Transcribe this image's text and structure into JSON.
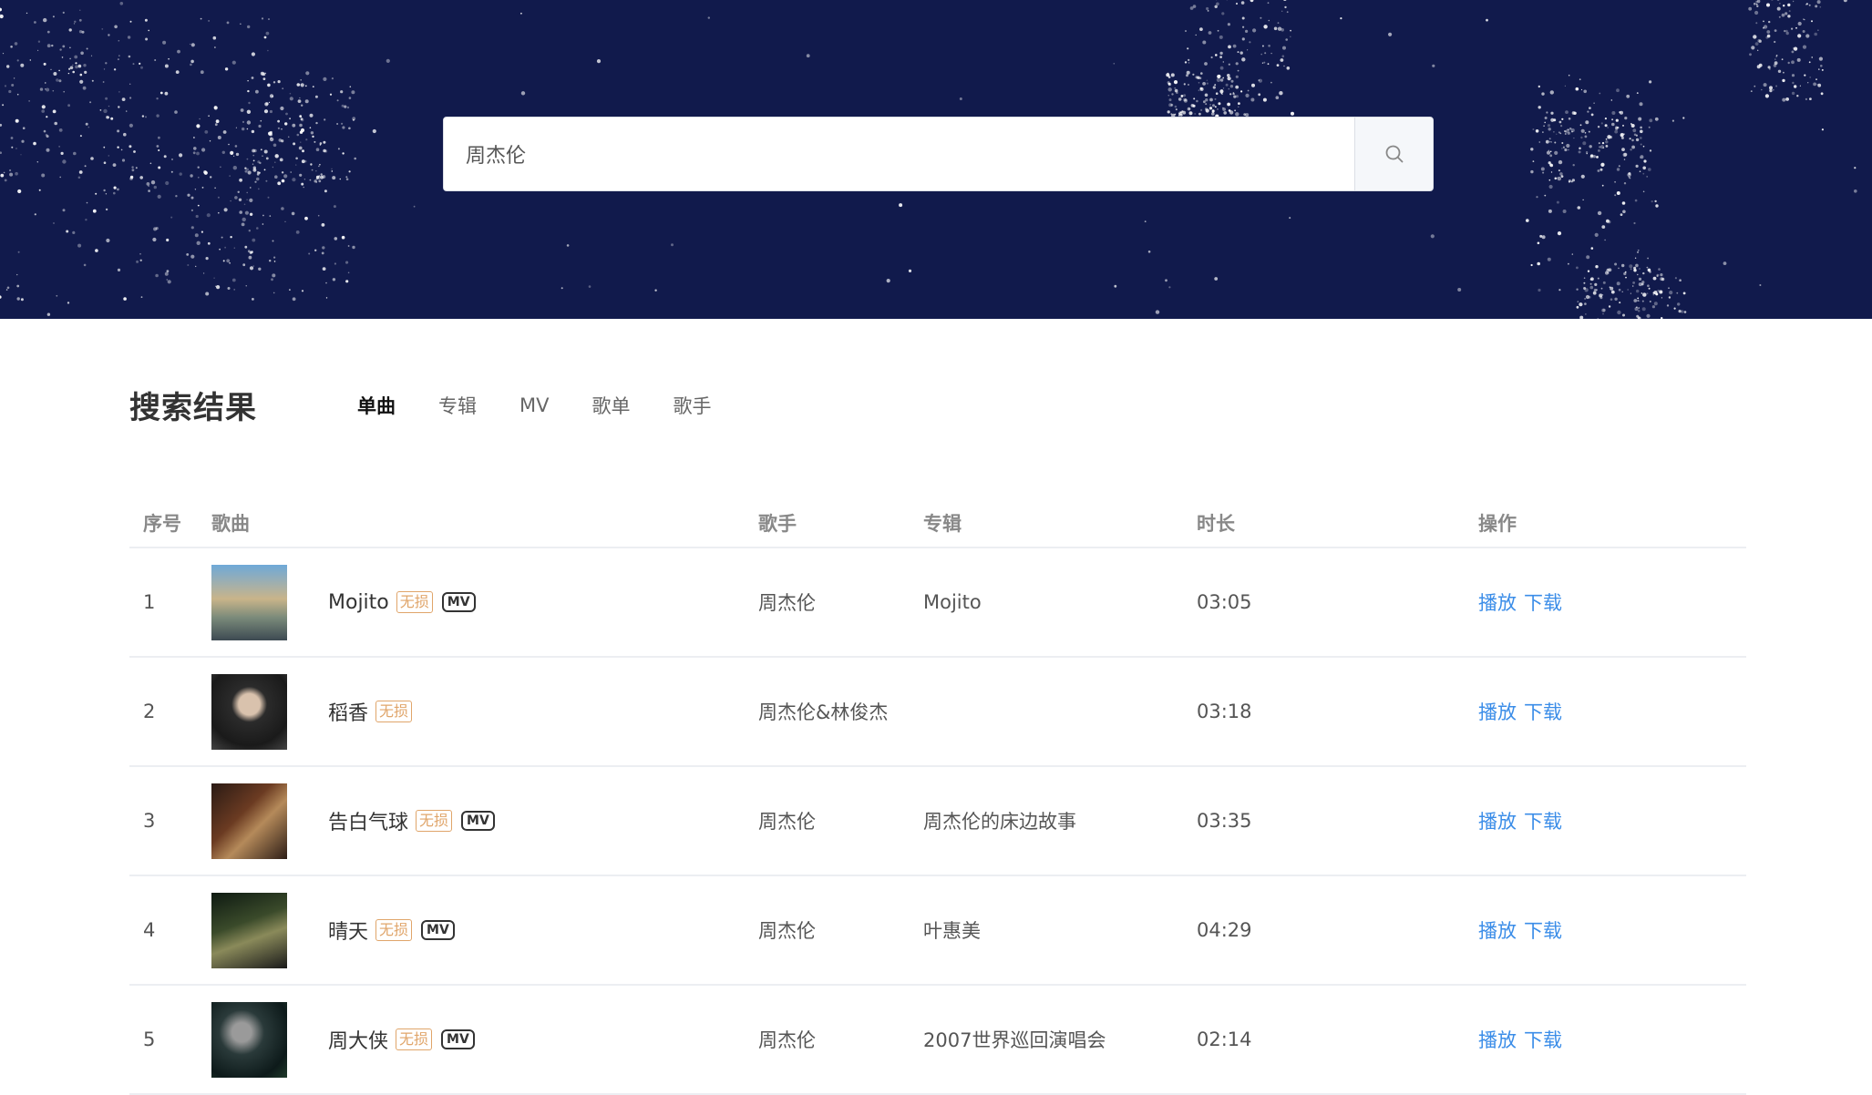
{
  "search": {
    "value": "周杰伦"
  },
  "results": {
    "title": "搜索结果",
    "tabs": [
      "单曲",
      "专辑",
      "MV",
      "歌单",
      "歌手"
    ],
    "active_tab": 0
  },
  "table": {
    "headers": {
      "no": "序号",
      "song": "歌曲",
      "singer": "歌手",
      "album": "专辑",
      "duration": "时长",
      "ops": "操作"
    },
    "lossless_label": "无损",
    "mv_label": "MV",
    "play_label": "播放",
    "download_label": "下载",
    "rows": [
      {
        "no": "1",
        "title": "Mojito",
        "lossless": true,
        "mv": true,
        "singer": "周杰伦",
        "album": "Mojito",
        "duration": "03:05"
      },
      {
        "no": "2",
        "title": "稻香",
        "lossless": true,
        "mv": false,
        "singer": "周杰伦&林俊杰",
        "album": "",
        "duration": "03:18"
      },
      {
        "no": "3",
        "title": "告白气球",
        "lossless": true,
        "mv": true,
        "singer": "周杰伦",
        "album": "周杰伦的床边故事",
        "duration": "03:35"
      },
      {
        "no": "4",
        "title": "晴天",
        "lossless": true,
        "mv": true,
        "singer": "周杰伦",
        "album": "叶惠美",
        "duration": "04:29"
      },
      {
        "no": "5",
        "title": "周大侠",
        "lossless": true,
        "mv": true,
        "singer": "周杰伦",
        "album": "2007世界巡回演唱会",
        "duration": "02:14"
      }
    ]
  },
  "colors": {
    "hero_bg": "#111a4c",
    "accent": "#ffe000",
    "link": "#3b8de8",
    "lossless": "#e0a56a"
  }
}
